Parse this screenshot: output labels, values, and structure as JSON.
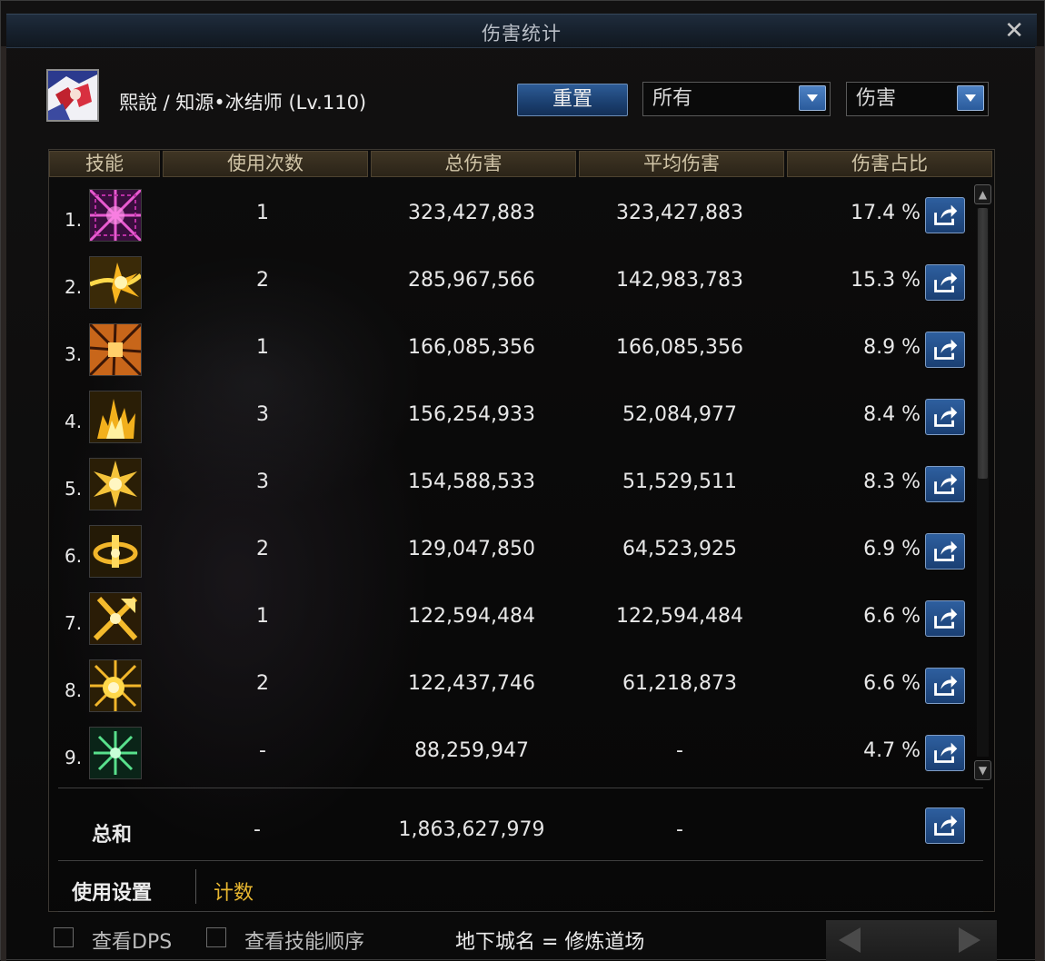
{
  "window": {
    "title": "伤害统计",
    "close_glyph": "✕"
  },
  "character": {
    "name": "熙說 / 知源•冰结师 (Lv.110)"
  },
  "toolbar": {
    "reset_label": "重置",
    "filter_select": "所有",
    "metric_select": "伤害"
  },
  "table": {
    "headers": {
      "skill": "技能",
      "count": "使用次数",
      "total": "总伤害",
      "avg": "平均伤害",
      "pct": "伤害占比"
    },
    "rows": [
      {
        "idx": "1.",
        "count": "1",
        "total": "323,427,883",
        "avg": "323,427,883",
        "pct": "17.4 %",
        "icon": "purple-burst-skill-icon"
      },
      {
        "idx": "2.",
        "count": "2",
        "total": "285,967,566",
        "avg": "142,983,783",
        "pct": "15.3 %",
        "icon": "golden-wave-skill-icon"
      },
      {
        "idx": "3.",
        "count": "1",
        "total": "166,085,356",
        "avg": "166,085,356",
        "pct": "8.9 %",
        "icon": "orange-shatter-skill-icon"
      },
      {
        "idx": "4.",
        "count": "3",
        "total": "156,254,933",
        "avg": "52,084,977",
        "pct": "8.4 %",
        "icon": "golden-flame-skill-icon"
      },
      {
        "idx": "5.",
        "count": "3",
        "total": "154,588,533",
        "avg": "51,529,511",
        "pct": "8.3 %",
        "icon": "golden-star-skill-icon"
      },
      {
        "idx": "6.",
        "count": "2",
        "total": "129,047,850",
        "avg": "64,523,925",
        "pct": "6.9 %",
        "icon": "golden-ring-skill-icon"
      },
      {
        "idx": "7.",
        "count": "1",
        "total": "122,594,484",
        "avg": "122,594,484",
        "pct": "6.6 %",
        "icon": "golden-cross-skill-icon"
      },
      {
        "idx": "8.",
        "count": "2",
        "total": "122,437,746",
        "avg": "61,218,873",
        "pct": "6.6 %",
        "icon": "golden-nova-skill-icon"
      },
      {
        "idx": "9.",
        "count": "-",
        "total": "88,259,947",
        "avg": "-",
        "pct": "4.7 %",
        "icon": "green-snowflake-skill-icon"
      }
    ],
    "sum": {
      "label": "总和",
      "count": "-",
      "total": "1,863,627,979",
      "avg": "-"
    }
  },
  "tabs": {
    "settings": "使用设置",
    "count": "计数"
  },
  "footer": {
    "view_dps": "查看DPS",
    "view_skill_order": "查看技能顺序",
    "dungeon": "地下城名 = 修炼道场"
  },
  "colors": {
    "accent_blue": "#2d5c97",
    "tab_active": "#e8b730",
    "header_gold": "#cfc3a6"
  }
}
